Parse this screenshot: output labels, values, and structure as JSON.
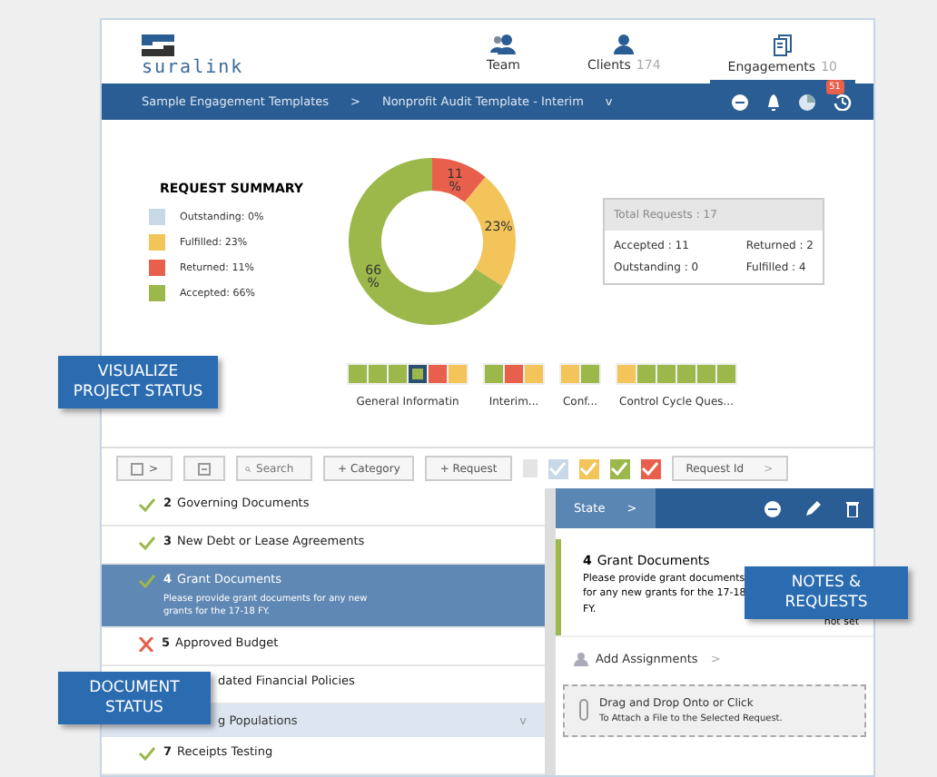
{
  "header": {
    "logo": "suralink",
    "nav": [
      {
        "label": "Team",
        "selected": false,
        "kind": "team"
      },
      {
        "label": "Clients",
        "count": "174",
        "selected": false,
        "kind": "client"
      },
      {
        "label": "Engagements",
        "count": "10",
        "selected": true,
        "kind": "doc"
      }
    ]
  },
  "breadcrumb": {
    "items": [
      "Sample Engagement Templates",
      "Nonprofit Audit Template - Interim"
    ],
    "separator": ">",
    "caret": "v",
    "badge": "51"
  },
  "summary": {
    "title": "REQUEST SUMMARY",
    "legend": [
      {
        "label": "Outstanding: 0%",
        "color": "#c9d8e6"
      },
      {
        "label": "Fulfilled: 23%",
        "color": "#f2c45a"
      },
      {
        "label": "Returned: 11%",
        "color": "#e8604c"
      },
      {
        "label": "Accepted: 66%",
        "color": "#9cb84a"
      }
    ],
    "chart_data": {
      "type": "donut",
      "series": [
        {
          "values": [
            11,
            23,
            66
          ]
        }
      ],
      "colors": [
        "#e8604c",
        "#f2c45a",
        "#9cb84a"
      ],
      "value_labels": [
        "11 %",
        "23%",
        "66 %"
      ]
    },
    "totals": {
      "title": "Total Requests : 17",
      "cells": [
        "Accepted : 11",
        "Returned : 2",
        "Outstanding : 0",
        "Fulfilled : 4"
      ]
    }
  },
  "progress_groups": [
    {
      "label": "General Informatin",
      "squares": [
        {
          "color": "#9cb84a",
          "selected": false
        },
        {
          "color": "#9cb84a",
          "selected": false
        },
        {
          "color": "#9cb84a",
          "selected": false
        },
        {
          "color": "#9cb84a",
          "selected": true
        },
        {
          "color": "#e8604c",
          "selected": false
        },
        {
          "color": "#f2c45a",
          "selected": false
        }
      ]
    },
    {
      "label": "Interim...",
      "squares": [
        {
          "color": "#9cb84a",
          "selected": false
        },
        {
          "color": "#e8604c",
          "selected": false
        },
        {
          "color": "#f2c45a",
          "selected": false
        }
      ]
    },
    {
      "label": "Conf...",
      "squares": [
        {
          "color": "#f2c45a",
          "selected": false
        },
        {
          "color": "#9cb84a",
          "selected": false
        }
      ]
    },
    {
      "label": "Control Cycle Ques...",
      "squares": [
        {
          "color": "#f2c45a",
          "selected": false
        },
        {
          "color": "#9cb84a",
          "selected": false
        },
        {
          "color": "#9cb84a",
          "selected": false
        },
        {
          "color": "#9cb84a",
          "selected": false
        },
        {
          "color": "#9cb84a",
          "selected": false
        },
        {
          "color": "#9cb84a",
          "selected": false
        }
      ]
    }
  ],
  "toolbar": {
    "expand": ">",
    "search": {
      "placeholder": "Search"
    },
    "buttons": [
      "+ Category",
      "+ Request"
    ],
    "filters": [
      {
        "color": "#c9d8e6"
      },
      {
        "color": "#f2c45a"
      },
      {
        "color": "#9cb84a"
      },
      {
        "color": "#e8604c"
      }
    ],
    "sort": {
      "label": "Request Id",
      "arrow": ">"
    }
  },
  "requests": [
    {
      "kind": "request",
      "number": "2",
      "title": "Governing Documents",
      "returned": false,
      "selected": false
    },
    {
      "kind": "request",
      "number": "3",
      "title": "New Debt or Lease Agreements",
      "returned": false,
      "selected": false
    },
    {
      "kind": "request",
      "number": "4",
      "title": "Grant Documents",
      "description": "Please provide grant documents for any new grants for the 17-18 FY.",
      "returned": false,
      "selected": true
    },
    {
      "kind": "request",
      "number": "5",
      "title": "Approved Budget",
      "returned": true,
      "selected": false
    },
    {
      "kind": "request",
      "title": "dated Financial Policies",
      "selected": false
    },
    {
      "kind": "category",
      "title": "g Populations",
      "chevron": "v"
    },
    {
      "kind": "request",
      "number": "7",
      "title": "Receipts Testing",
      "returned": false,
      "selected": false
    }
  ],
  "detail": {
    "state": "State",
    "state_arrow": ">",
    "number": "4",
    "title": "Grant Documents",
    "description": "Please provide grant documents for any new grants for the 17-18 FY.",
    "due": "not set",
    "assign": "Add Assignments",
    "assign_arrow": ">",
    "drop_title": "Drag and Drop Onto or Click",
    "drop_hint": "To Attach a File to the Selected Request."
  },
  "callouts": [
    {
      "kind": "visualize",
      "text": "VISUALIZE PROJECT STATUS"
    },
    {
      "kind": "notes",
      "text": "NOTES & REQUESTS"
    },
    {
      "kind": "document",
      "text": "DOCUMENT STATUS"
    }
  ]
}
